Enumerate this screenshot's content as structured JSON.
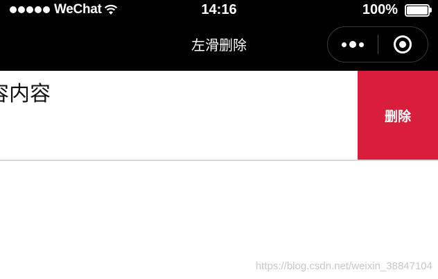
{
  "status_bar": {
    "carrier": "WeChat",
    "time": "14:16",
    "battery": "100%",
    "battery_level": 1.0
  },
  "nav_bar": {
    "title": "左滑删除",
    "more_icon": "more-dots-icon",
    "close_icon": "target-close-icon"
  },
  "list": {
    "items": [
      {
        "content": "容内容",
        "delete_label": "删除"
      }
    ]
  },
  "watermark": "https://blog.csdn.net/weixin_38847104",
  "colors": {
    "bar_background": "#000000",
    "delete_background": "#d81e3c",
    "divider": "#d9d9d9"
  }
}
